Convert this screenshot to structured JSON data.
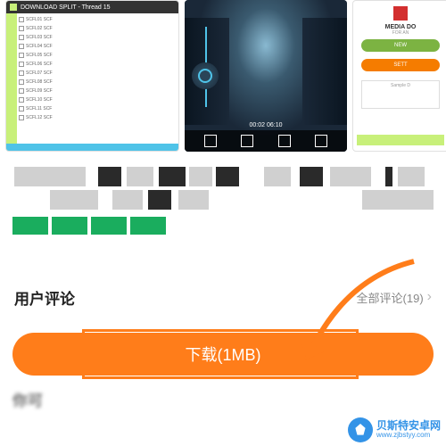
{
  "screenshots": {
    "shot1": {
      "header": "DOWNLOAD SPLIT - Thread 15",
      "rows": [
        "SCFL01 SCF",
        "SCFL02 SCF",
        "SCFL03 SCF",
        "SCFL04 SCF",
        "SCFL05 SCF",
        "SCFL06 SCF",
        "SCFL07 SCF",
        "SCFL08 SCF",
        "SCFL09 SCF",
        "SCFL10 SCF",
        "SCFL11 SCF",
        "SCFL12 SCF"
      ]
    },
    "shot2": {
      "time": "00:02   06:10"
    },
    "shot3": {
      "title": "MEDIA DO",
      "sub": "FOR AN",
      "btn1": "NEW",
      "btn2": "SETT",
      "box_header": "Sample D"
    }
  },
  "reviews": {
    "title": "用户评论",
    "all_label": "全部评论(19)"
  },
  "download": {
    "label": "下载(1MB)"
  },
  "bottom": {
    "text": "你可"
  },
  "watermark": {
    "cn": "贝斯特安卓网",
    "url": "www.zjbstyy.com"
  }
}
